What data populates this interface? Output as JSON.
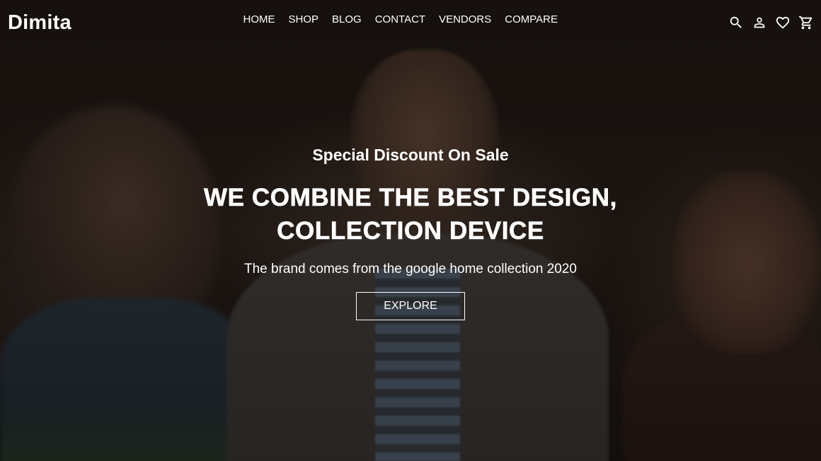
{
  "header": {
    "logo": "Dimita",
    "nav": [
      {
        "label": "HOME"
      },
      {
        "label": "SHOP"
      },
      {
        "label": "BLOG"
      },
      {
        "label": "CONTACT"
      },
      {
        "label": "VENDORS"
      },
      {
        "label": "COMPARE"
      }
    ],
    "icons": [
      "search-icon",
      "account-icon",
      "wishlist-heart-icon",
      "cart-icon"
    ]
  },
  "hero": {
    "subtitle": "Special Discount On Sale",
    "headline_line1": "WE COMBINE THE BEST DESIGN,",
    "headline_line2": "COLLECTION DEVICE",
    "tagline": "The brand comes from the google home collection 2020",
    "cta_label": "EXPLORE"
  },
  "colors": {
    "text": "#ffffff",
    "overlay": "#000000"
  }
}
